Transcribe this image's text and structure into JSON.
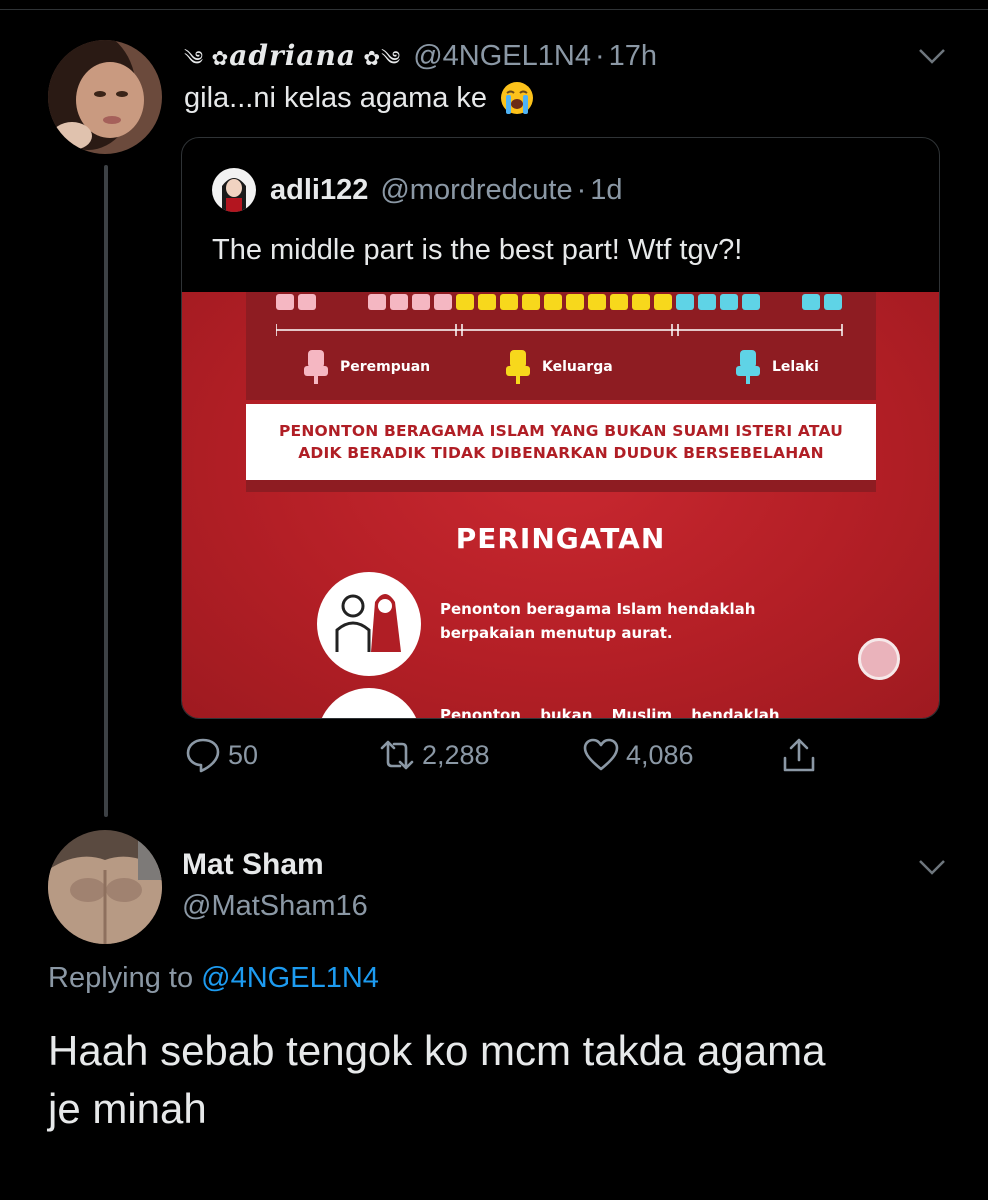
{
  "tweet1": {
    "display_name": "டadriana❀",
    "display_name_text": "adriana",
    "handle": "@4NGEL1N4",
    "dot": "·",
    "time": "17h",
    "text": "gila...ni kelas agama ke",
    "emoji_icon": "loudly-crying-face-icon",
    "quote": {
      "name": "adli122",
      "handle": "@mordredcute",
      "dot": "·",
      "time": "1d",
      "text": "The middle part is the best part! Wtf tgv?!",
      "media": {
        "legend": [
          "Perempuan",
          "Keluarga",
          "Lelaki"
        ],
        "seat_colors": {
          "perempuan": "#f5b7c2",
          "keluarga": "#f7d81c",
          "lelaki": "#5fd3e6"
        },
        "notice_lines": [
          "PENONTON BERAGAMA ISLAM YANG BUKAN SUAMI ISTERI ATAU",
          "ADIK BERADIK TIDAK DIBENARKAN DUDUK BERSEBELAHAN"
        ],
        "warning_title": "PERINGATAN",
        "warning_lines": [
          "Penonton beragama Islam hendaklah",
          "berpakaian menutup aurat."
        ],
        "warning2_partial": "Penonton bukan Muslim hendaklah"
      }
    },
    "actions": {
      "replies": "50",
      "retweets": "2,288",
      "likes": "4,086"
    }
  },
  "tweet2": {
    "name": "Mat Sham",
    "handle": "@MatSham16",
    "replying_prefix": "Replying to ",
    "replying_to": "@4NGEL1N4",
    "text_line1": "Haah sebab tengok ko mcm takda agama",
    "text_line2": "je minah"
  },
  "colors": {
    "background": "#000000",
    "secondary_text": "#8b98a5",
    "link": "#1d9bf0",
    "media_red": "#b41f26"
  }
}
